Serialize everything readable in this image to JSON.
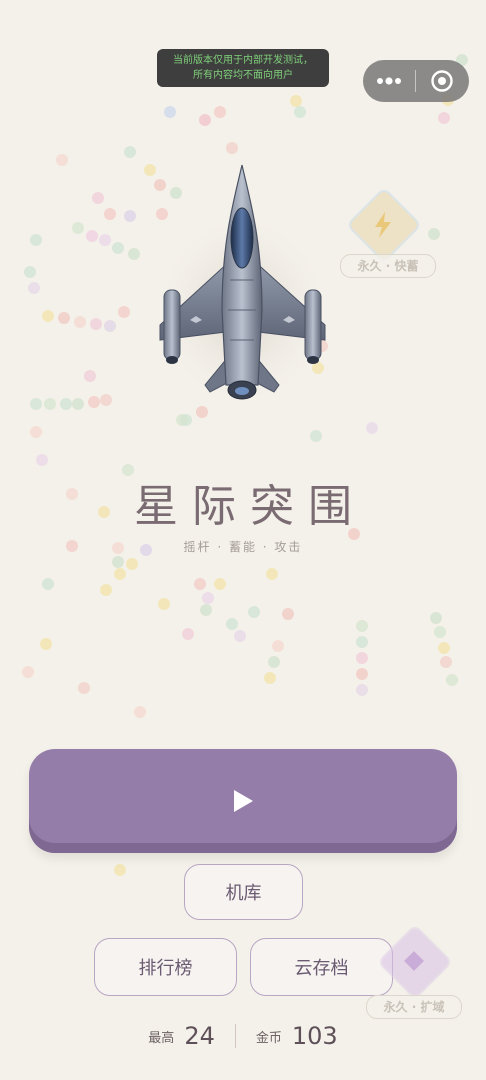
{
  "dev_banner": {
    "line1": "当前版本仅用于内部开发测试，",
    "line2": "所有内容均不面向用户"
  },
  "menu_capsule": {
    "more_icon": "more-dots-icon",
    "close_icon": "target-close-icon"
  },
  "badges": [
    {
      "label": "永久 · 快蓄",
      "icon": "lightning-icon",
      "color": "#e3c57a"
    },
    {
      "label": "永久 · 扩域",
      "icon": "diamond-gem-icon",
      "color": "#c6a6d6"
    }
  ],
  "game": {
    "title": "星际突围",
    "subtitle": "摇杆 · 蓄能 · 攻击"
  },
  "buttons": {
    "play_icon": "play-triangle-icon",
    "hangar": "机库",
    "leaderboard": "排行榜",
    "cloud_save": "云存档"
  },
  "stats": {
    "best_label": "最高",
    "best_value": "24",
    "coins_label": "金币",
    "coins_value": "103"
  },
  "colors": {
    "background": "#f4f1ea",
    "primary": "#957daa",
    "title": "#7a6b72"
  }
}
